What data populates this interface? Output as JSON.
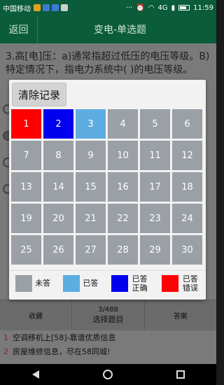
{
  "status_bar": {
    "carrier": "中国移动",
    "network": "4G",
    "time": "11:59",
    "icons": [
      {
        "name": "app-notification-icon",
        "color": "#e6a01e"
      },
      {
        "name": "app-notification-icon",
        "color": "#3b7bd6"
      },
      {
        "name": "app-notification-icon",
        "color": "#3b7bd6"
      },
      {
        "name": "app-notification-icon",
        "color": "#cfcfcf"
      }
    ]
  },
  "header": {
    "back_label": "返回",
    "title": "变电-单选题"
  },
  "question": {
    "text": "3.高[电]压：a)通常指超过低压的电压等级。B)特定情况下，指电力系统中(    )的电压等级。"
  },
  "dialog": {
    "clear_label": "清除记录",
    "questions": [
      {
        "num": "1",
        "state": "wrong"
      },
      {
        "num": "2",
        "state": "correct"
      },
      {
        "num": "3",
        "state": "answered"
      },
      {
        "num": "4",
        "state": "unanswered"
      },
      {
        "num": "5",
        "state": "unanswered"
      },
      {
        "num": "6",
        "state": "unanswered"
      },
      {
        "num": "7",
        "state": "unanswered"
      },
      {
        "num": "8",
        "state": "unanswered"
      },
      {
        "num": "9",
        "state": "unanswered"
      },
      {
        "num": "10",
        "state": "unanswered"
      },
      {
        "num": "11",
        "state": "unanswered"
      },
      {
        "num": "12",
        "state": "unanswered"
      },
      {
        "num": "13",
        "state": "unanswered"
      },
      {
        "num": "14",
        "state": "unanswered"
      },
      {
        "num": "15",
        "state": "unanswered"
      },
      {
        "num": "16",
        "state": "unanswered"
      },
      {
        "num": "17",
        "state": "unanswered"
      },
      {
        "num": "18",
        "state": "unanswered"
      },
      {
        "num": "19",
        "state": "unanswered"
      },
      {
        "num": "20",
        "state": "unanswered"
      },
      {
        "num": "21",
        "state": "unanswered"
      },
      {
        "num": "22",
        "state": "unanswered"
      },
      {
        "num": "23",
        "state": "unanswered"
      },
      {
        "num": "24",
        "state": "unanswered"
      },
      {
        "num": "25",
        "state": "unanswered"
      },
      {
        "num": "26",
        "state": "unanswered"
      },
      {
        "num": "27",
        "state": "unanswered"
      },
      {
        "num": "28",
        "state": "unanswered"
      },
      {
        "num": "29",
        "state": "unanswered"
      },
      {
        "num": "30",
        "state": "unanswered"
      },
      {
        "num": "31",
        "state": "unanswered"
      },
      {
        "num": "32",
        "state": "unanswered"
      },
      {
        "num": "33",
        "state": "unanswered"
      },
      {
        "num": "34",
        "state": "unanswered"
      },
      {
        "num": "35",
        "state": "unanswered"
      },
      {
        "num": "36",
        "state": "unanswered"
      }
    ],
    "legend": [
      {
        "key": "unanswered",
        "label": "未答",
        "color": "#9aa0a6"
      },
      {
        "key": "answered",
        "label": "已答",
        "color": "#5dade2"
      },
      {
        "key": "correct",
        "label": "已答正确",
        "color": "#0000ee"
      },
      {
        "key": "wrong",
        "label": "已答错误",
        "color": "#ff0000"
      }
    ]
  },
  "action_bar": {
    "favorite_label": "收藏",
    "progress": "3/488",
    "select_label": "选择题目",
    "answer_label": "答案"
  },
  "ads": [
    {
      "num": "1",
      "text": "空调移机上[58]-靠谱优质信息"
    },
    {
      "num": "2",
      "text": "房屋维修信息，尽在58同城!"
    }
  ]
}
